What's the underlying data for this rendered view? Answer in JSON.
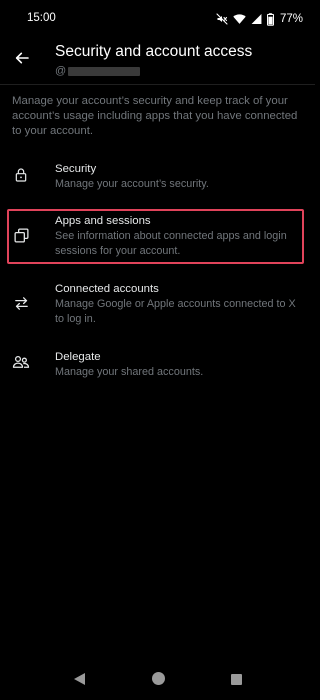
{
  "status_bar": {
    "time": "15:00",
    "battery": "77%",
    "icons": [
      "mute-icon",
      "wifi-icon",
      "signal-icon",
      "battery-icon"
    ]
  },
  "header": {
    "title": "Security and account access",
    "handle_prefix": "@",
    "back_icon": "arrow-left-icon"
  },
  "intro": "Manage your account’s security and keep track of your account’s usage including apps that you have connected to your account.",
  "items": [
    {
      "icon": "lock-icon",
      "title": "Security",
      "description": "Manage your account’s security."
    },
    {
      "icon": "copy-windows-icon",
      "title": "Apps and sessions",
      "description": "See information about connected apps and login sessions for your account.",
      "highlighted": true
    },
    {
      "icon": "swap-arrows-icon",
      "title": "Connected accounts",
      "description": "Manage Google or Apple accounts connected to X to log in."
    },
    {
      "icon": "people-icon",
      "title": "Delegate",
      "description": "Manage your shared accounts."
    }
  ],
  "nav_bar": {
    "buttons": [
      "back-triangle-icon",
      "home-circle-icon",
      "recents-square-icon"
    ]
  },
  "colors": {
    "background": "#000000",
    "primary_text": "#e7e9ea",
    "secondary_text": "#71767b",
    "highlight": "#e0435a"
  }
}
